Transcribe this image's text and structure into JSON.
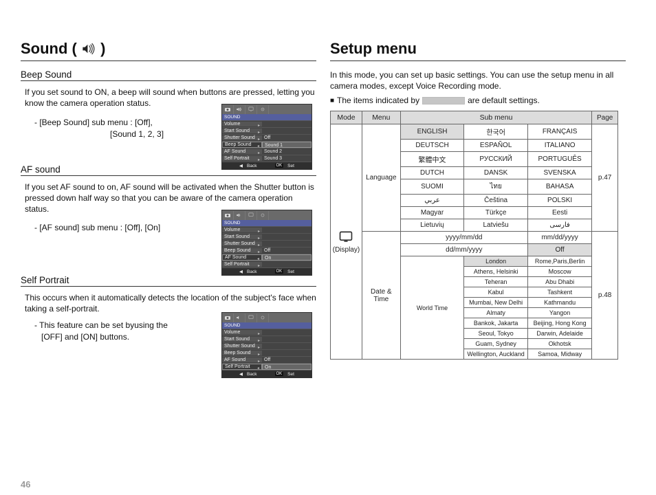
{
  "pageNumber": "46",
  "leftColumn": {
    "title": "Sound (",
    "titleClose": ")",
    "beep": {
      "heading": "Beep Sound",
      "body": "If you set sound to ON, a beep will sound when buttons are pressed, letting you know the camera operation status.",
      "subline1": "- [Beep Sound] sub menu : [Off],",
      "subline2": "[Sound 1, 2, 3]"
    },
    "af": {
      "heading": "AF sound",
      "body": "If you set AF sound to on, AF sound will be activated when the Shutter button is pressed down half way so that you can be aware of the camera operation status.",
      "subline1": "- [AF sound] sub menu : [Off], [On]"
    },
    "self": {
      "heading": "Self Portrait",
      "body": "This occurs when it automatically detects the location of the subject's face when taking a self-portrait.",
      "subline1": "- This feature can be set byusing the",
      "subline2": "[OFF] and [ON] buttons."
    },
    "mini": {
      "crumb": "SOUND",
      "rows": [
        "Volume",
        "Start Sound",
        "Shutter Sound",
        "Beep Sound",
        "AF Sound",
        "Self Portrait"
      ],
      "footBack": "Back",
      "footOK": "OK",
      "footSet": "Set",
      "beepValues": [
        "Off",
        "Sound 1",
        "Sound 2",
        "Sound 3"
      ],
      "afValues": [
        "Off",
        "On"
      ],
      "selfValues": [
        "Off",
        "On"
      ]
    }
  },
  "rightColumn": {
    "title": "Setup menu",
    "intro": "In this mode, you can set up basic settings. You can use the setup menu in all camera modes, except Voice Recording mode.",
    "bulletPre": "The items indicated by",
    "bulletPost": "are default settings.",
    "table": {
      "headers": {
        "mode": "Mode",
        "menu": "Menu",
        "submenu": "Sub menu",
        "page": "Page"
      },
      "modeLabel": "(Display)",
      "languageMenu": "Language",
      "languagePage": "p.47",
      "languageGrid": [
        [
          "ENGLISH",
          "한국어",
          "FRANÇAIS"
        ],
        [
          "DEUTSCH",
          "ESPAÑOL",
          "ITALIANO"
        ],
        [
          "繁體中文",
          "РУССКИЙ",
          "PORTUGUÊS"
        ],
        [
          "DUTCH",
          "DANSK",
          "SVENSKA"
        ],
        [
          "SUOMI",
          "ไทย",
          "BAHASA"
        ],
        [
          "عربي",
          "Čeština",
          "POLSKI"
        ],
        [
          "Magyar",
          "Türkçe",
          "Eesti"
        ],
        [
          "Lietuvių",
          "Latviešu",
          "فارسی"
        ]
      ],
      "dateMenu": "Date & Time",
      "datePage": "p.48",
      "dateFmtRow1": [
        "yyyy/mm/dd",
        "mm/dd/yyyy"
      ],
      "dateFmtRow2": [
        "dd/mm/yyyy",
        "Off"
      ],
      "worldTimeLabel": "World Time",
      "worldTimeGrid": [
        [
          "London",
          "Rome,Paris,Berlin"
        ],
        [
          "Athens, Helsinki",
          "Moscow"
        ],
        [
          "Teheran",
          "Abu Dhabi"
        ],
        [
          "Kabul",
          "Tashkent"
        ],
        [
          "Mumbai, New Delhi",
          "Kathmandu"
        ],
        [
          "Almaty",
          "Yangon"
        ],
        [
          "Bankok, Jakarta",
          "Beijing, Hong Kong"
        ],
        [
          "Seoul, Tokyo",
          "Darwin, Adelaide"
        ],
        [
          "Guam, Sydney",
          "Okhotsk"
        ],
        [
          "Wellington, Auckland",
          "Samoa, Midway"
        ]
      ]
    }
  }
}
